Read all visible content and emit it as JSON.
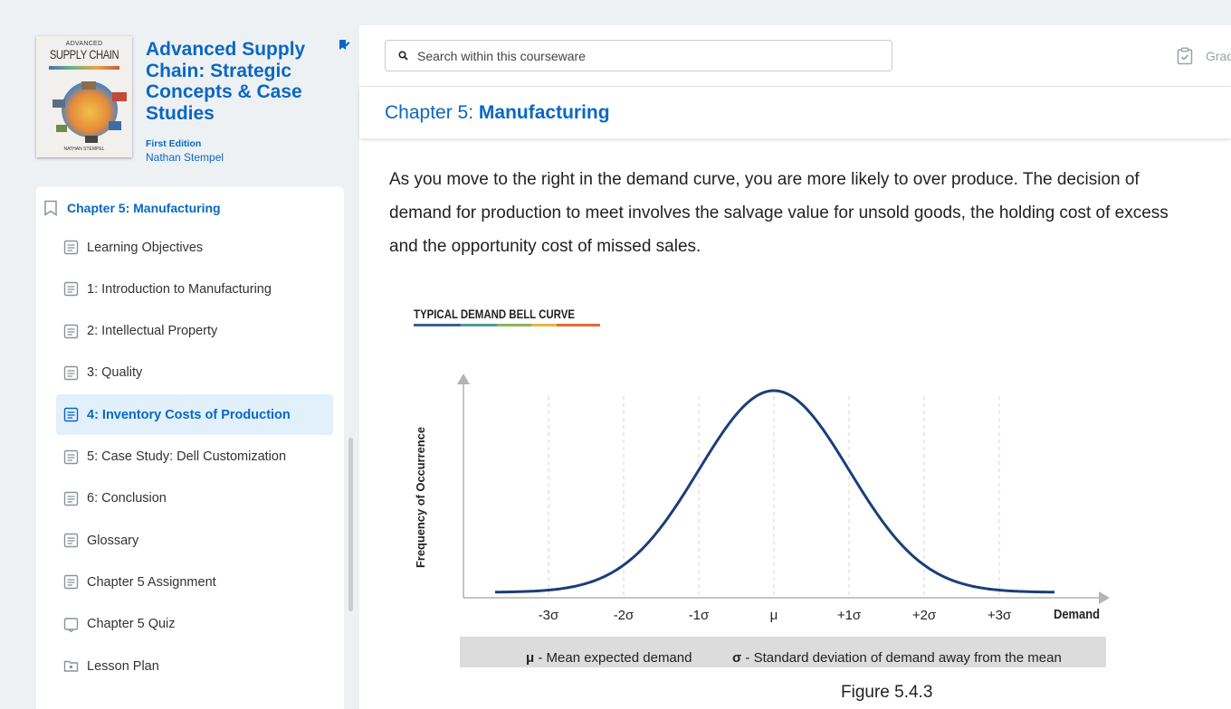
{
  "book": {
    "cover_small": "ADVANCED",
    "cover_big": "SUPPLY CHAIN",
    "cover_author": "NATHAN STEMPEL",
    "title": "Advanced Supply Chain: Strategic Concepts & Case Studies",
    "edition": "First Edition",
    "author": "Nathan Stempel"
  },
  "toc": {
    "header": "Chapter 5: Manufacturing",
    "items": [
      {
        "label": "Learning Objectives",
        "icon": "document-icon"
      },
      {
        "label": "1: Introduction to Manufacturing",
        "icon": "document-icon"
      },
      {
        "label": "2: Intellectual Property",
        "icon": "document-icon"
      },
      {
        "label": "3: Quality",
        "icon": "document-icon"
      },
      {
        "label": "4: Inventory Costs of Production",
        "icon": "document-icon",
        "active": true
      },
      {
        "label": "5: Case Study: Dell Customization",
        "icon": "document-icon"
      },
      {
        "label": "6: Conclusion",
        "icon": "document-icon"
      },
      {
        "label": "Glossary",
        "icon": "document-icon"
      },
      {
        "label": "Chapter 5 Assignment",
        "icon": "document-icon"
      },
      {
        "label": "Chapter 5 Quiz",
        "icon": "quiz-icon"
      },
      {
        "label": "Lesson Plan",
        "icon": "folder-icon"
      }
    ]
  },
  "search": {
    "placeholder": "Search within this courseware"
  },
  "grades": {
    "label": "Grades"
  },
  "chapter": {
    "prefix": "Chapter 5: ",
    "name": "Manufacturing"
  },
  "content": {
    "paragraph": "As you move to the right in the demand curve, you are more likely to over produce. The decision of\ndemand for production to meet involves the salvage value for unsold goods, the holding cost of excess\nand the opportunity cost of missed sales."
  },
  "figure": {
    "heading": "TYPICAL DEMAND BELL CURVE",
    "ylabel": "Frequency of Occurrence",
    "xlabel": "Demand",
    "ticks": [
      "-3σ",
      "-2σ",
      "-1σ",
      "μ",
      "+1σ",
      "+2σ",
      "+3σ"
    ],
    "legend_mu_symbol": "μ",
    "legend_mu_text": " - Mean expected demand",
    "legend_sigma_symbol": "σ",
    "legend_sigma_text": " - Standard deviation of demand away from the mean",
    "caption": "Figure 5.4.3"
  },
  "colors": {
    "accent": "#0a67c3",
    "curve": "#1b3e7a",
    "active_bg": "#e1f0fb"
  }
}
